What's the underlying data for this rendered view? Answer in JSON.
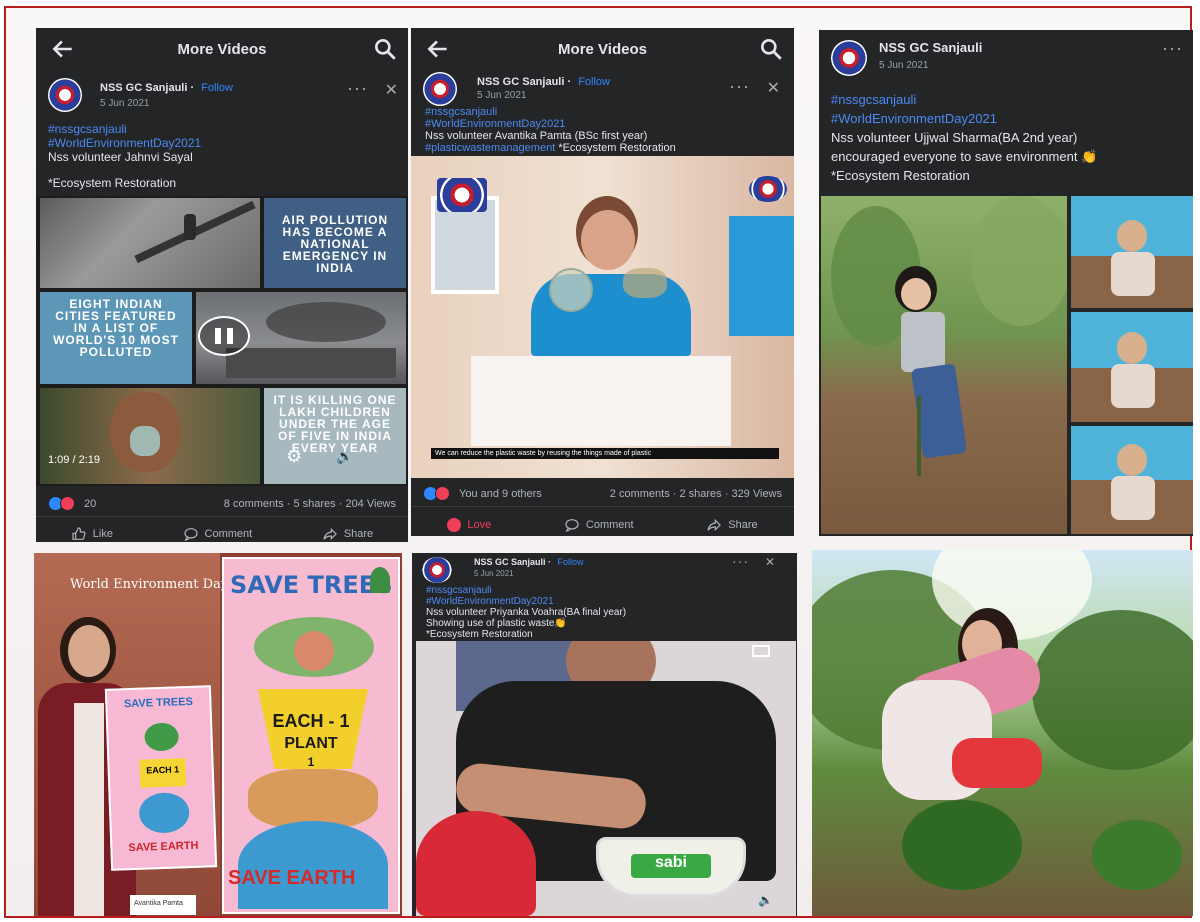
{
  "panel1": {
    "topbar_title": "More Videos",
    "page_name": "NSS GC Sanjauli",
    "follow": "Follow",
    "date": "5 Jun 2021",
    "hashtag1": "#nssgcsanjauli",
    "hashtag2": "#WorldEnvironmentDay2021",
    "caption_line": "Nss volunteer Jahnvi Sayal",
    "tag": "*Ecosystem Restoration",
    "tile_air": "AIR POLLUTION HAS BECOME A NATIONAL EMERGENCY IN INDIA",
    "tile_cities": "EIGHT INDIAN CITIES FEATURED IN A LIST OF WORLD'S 10 MOST POLLUTED",
    "tile_killing": "IT IS KILLING ONE LAKH CHILDREN UNDER THE AGE OF FIVE IN INDIA EVERY YEAR",
    "video_time": "1:09 / 2:19",
    "reactions_count": "20",
    "stats": "8 comments · 5 shares · 204 Views",
    "like": "Like",
    "comment": "Comment",
    "share": "Share"
  },
  "panel2": {
    "topbar_title": "More Videos",
    "page_name": "NSS GC Sanjauli",
    "follow": "Follow",
    "date": "5 Jun 2021",
    "hashtag1": "#nssgcsanjauli",
    "hashtag2": "#WorldEnvironmentDay2021",
    "caption_line": "Nss volunteer Avantika Pamta (BSc first year)",
    "hashtag3": "#plasticwastemanagement",
    "tag": "*Ecosystem Restoration",
    "subtitle": "We can reduce the plastic waste by reusing the things made of plastic",
    "reactions_text": "You and 9 others",
    "stats": "2 comments · 2 shares · 329 Views",
    "love": "Love",
    "comment": "Comment",
    "share": "Share"
  },
  "panel3": {
    "page_name": "NSS GC Sanjauli",
    "date": "5 Jun 2021",
    "hashtag1": "#nssgcsanjauli",
    "hashtag2": "#WorldEnvironmentDay2021",
    "caption_line1": "Nss volunteer Ujjwal Sharma(BA 2nd year)",
    "caption_line2": "encouraged  everyone to save environment 👏",
    "tag": "*Ecosystem Restoration"
  },
  "panel4": {
    "banner": "World Environment Day",
    "poster_title": "SAVE TREES",
    "poster_each": "EACH - 1",
    "poster_plant": "PLANT",
    "poster_one": "1",
    "poster_bottom": "SAVE EARTH",
    "small_title": "SAVE TREES",
    "small_each": "EACH 1",
    "small_bottom": "SAVE EARTH",
    "name_tag": "Avantika Pamta"
  },
  "panel5": {
    "page_name": "NSS GC Sanjauli",
    "follow": "Follow",
    "date": "5 Jun 2021",
    "hashtag1": "#nssgcsanjauli",
    "hashtag2": "#WorldEnvironmentDay2021",
    "caption_line1": "Nss volunteer Priyanka Voahra(BA final year)",
    "caption_line2": "Showing use of plastic waste👏",
    "tag": "*Ecosystem Restoration",
    "tub_label": "sabi"
  },
  "colors": {
    "frame": "#b81d1d",
    "fb_dark": "#242526",
    "link_blue": "#2d88ff",
    "love_red": "#f33e58"
  }
}
